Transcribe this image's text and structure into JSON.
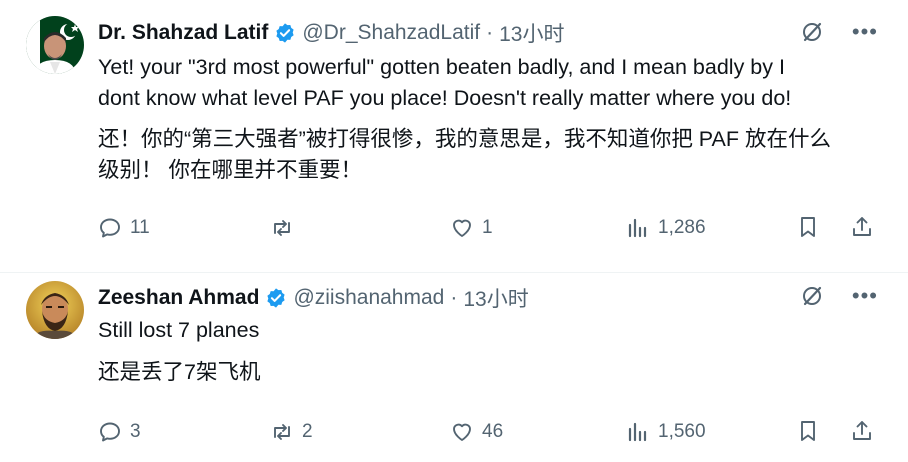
{
  "tweets": [
    {
      "name": "Dr. Shahzad Latif",
      "handle": "@Dr_ShahzadLatif",
      "separator": "·",
      "time": "13小时",
      "text_lines": [
        "Yet! your \"3rd most powerful\" gotten beaten badly, and I mean badly by I",
        "dont know what level PAF you place!  Doesn't really matter where you do!"
      ],
      "translation_lines": [
        "还！你的“第三大强者”被打得很惨，我的意思是，我不知道你把 PAF 放在什么",
        "级别！ 你在哪里并不重要！"
      ],
      "replies": "11",
      "reposts": "",
      "likes": "1",
      "views": "1,286"
    },
    {
      "name": "Zeeshan Ahmad",
      "handle": "@ziishanahmad",
      "separator": "·",
      "time": "13小时",
      "text_lines": [
        "Still lost 7 planes"
      ],
      "translation_lines": [
        "还是丢了7架飞机"
      ],
      "replies": "3",
      "reposts": "2",
      "likes": "46",
      "views": "1,560"
    }
  ],
  "colors": {
    "text": "#0f1419",
    "secondary": "#536471",
    "verified": "#1d9bf0",
    "pakistan_green": "#01411c"
  },
  "icons": [
    "reply-icon",
    "repost-icon",
    "like-icon",
    "views-icon",
    "bookmark-icon",
    "share-icon",
    "grok-icon",
    "more-icon",
    "verified-badge-icon"
  ]
}
